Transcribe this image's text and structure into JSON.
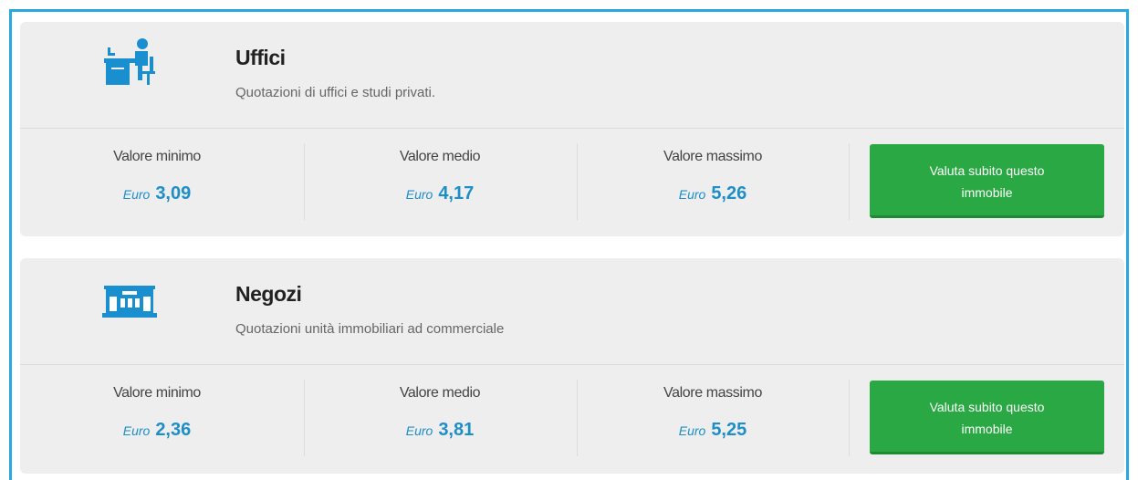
{
  "cards": [
    {
      "icon": "office-desk-icon",
      "title": "Uffici",
      "subtitle": "Quotazioni di uffici e studi privati.",
      "min_label": "Valore minimo",
      "min_currency": "Euro",
      "min_value": "3,09",
      "avg_label": "Valore medio",
      "avg_currency": "Euro",
      "avg_value": "4,17",
      "max_label": "Valore massimo",
      "max_currency": "Euro",
      "max_value": "5,26",
      "button_line1": "Valuta subito questo",
      "button_line2": "immobile"
    },
    {
      "icon": "store-icon",
      "title": "Negozi",
      "subtitle": "Quotazioni unità immobiliari ad commerciale",
      "min_label": "Valore minimo",
      "min_currency": "Euro",
      "min_value": "2,36",
      "avg_label": "Valore medio",
      "avg_currency": "Euro",
      "avg_value": "3,81",
      "max_label": "Valore massimo",
      "max_currency": "Euro",
      "max_value": "5,25",
      "button_line1": "Valuta subito questo",
      "button_line2": "immobile"
    }
  ],
  "colors": {
    "frame_border": "#29a8e0",
    "card_bg": "#eeeeee",
    "value_blue": "#1e8ec7",
    "button_green": "#2aa843",
    "icon_blue": "#1a8fd0"
  }
}
